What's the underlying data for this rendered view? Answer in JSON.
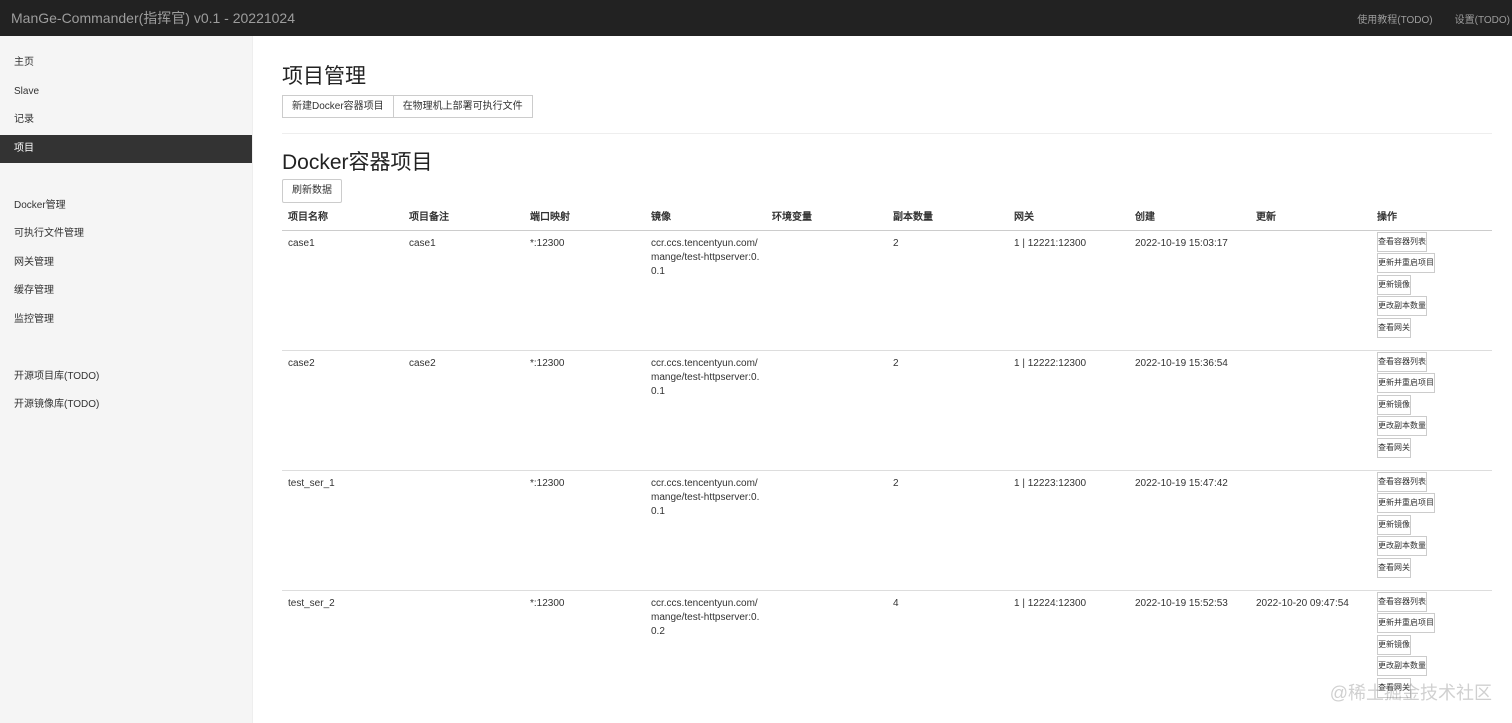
{
  "app": {
    "brand": "ManGe-Commander(指挥官) v0.1 - 20221024"
  },
  "topnav": {
    "tutorial": "使用教程(TODO)",
    "settings": "设置(TODO)"
  },
  "sidebar": {
    "items": [
      "主页",
      "Slave",
      "记录",
      "项目",
      "",
      "Docker管理",
      "可执行文件管理",
      "网关管理",
      "缓存管理",
      "监控管理",
      "",
      "开源项目库(TODO)",
      "开源镜像库(TODO)"
    ],
    "active": "项目"
  },
  "main": {
    "title": "项目管理",
    "new_docker_btn": "新建Docker容器项目",
    "deploy_exec_btn": "在物理机上部署可执行文件",
    "section_title": "Docker容器项目",
    "refresh_btn": "刷新数据"
  },
  "table": {
    "headers": [
      "项目名称",
      "项目备注",
      "端口映射",
      "镜像",
      "环境变量",
      "副本数量",
      "网关",
      "创建",
      "更新",
      "操作"
    ],
    "rows": [
      {
        "name": "case1",
        "note": "case1",
        "port": "*:12300",
        "image": "ccr.ccs.tencentyun.com/mange/test-httpserver:0.0.1",
        "env": "",
        "replicas": "2",
        "gateway": "1 | 12221:12300",
        "created": "2022-10-19 15:03:17",
        "updated": ""
      },
      {
        "name": "case2",
        "note": "case2",
        "port": "*:12300",
        "image": "ccr.ccs.tencentyun.com/mange/test-httpserver:0.0.1",
        "env": "",
        "replicas": "2",
        "gateway": "1 | 12222:12300",
        "created": "2022-10-19 15:36:54",
        "updated": ""
      },
      {
        "name": "test_ser_1",
        "note": "",
        "port": "*:12300",
        "image": "ccr.ccs.tencentyun.com/mange/test-httpserver:0.0.1",
        "env": "",
        "replicas": "2",
        "gateway": "1 | 12223:12300",
        "created": "2022-10-19 15:47:42",
        "updated": ""
      },
      {
        "name": "test_ser_2",
        "note": "",
        "port": "*:12300",
        "image": "ccr.ccs.tencentyun.com/mange/test-httpserver:0.0.2",
        "env": "",
        "replicas": "4",
        "gateway": "1 | 12224:12300",
        "created": "2022-10-19 15:52:53",
        "updated": "2022-10-20 09:47:54"
      }
    ],
    "ops": [
      "查看容器列表",
      "更新并重启项目",
      "更新镜像",
      "更改副本数量",
      "查看网关"
    ]
  },
  "watermark": "@稀土掘金技术社区"
}
